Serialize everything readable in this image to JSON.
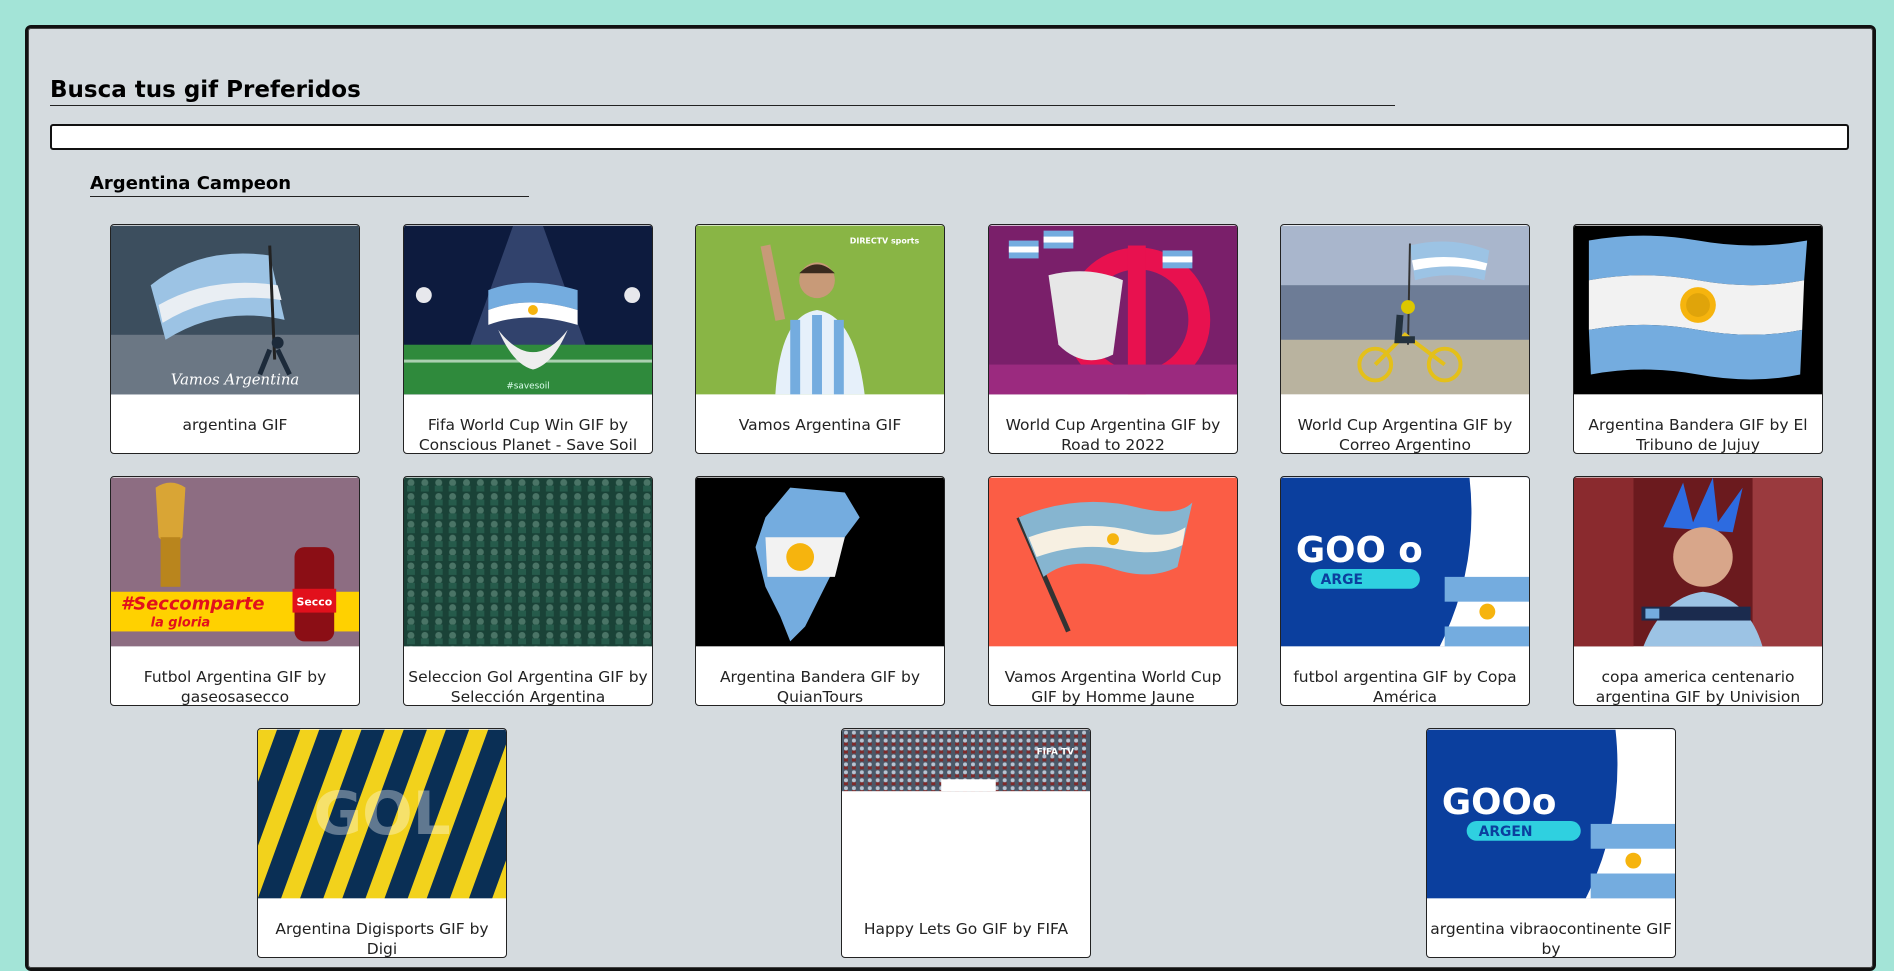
{
  "header": {
    "title": "Busca tus gif Preferidos"
  },
  "search": {
    "value": "",
    "placeholder": ""
  },
  "section": {
    "title": "Argentina Campeon"
  },
  "gifs": [
    {
      "caption": "argentina GIF",
      "icon": "flag-waver-image"
    },
    {
      "caption": "Fifa World Cup Win GIF by Conscious Planet - Save Soil",
      "icon": "mascot-flag-image"
    },
    {
      "caption": "Vamos Argentina GIF",
      "icon": "player-waving-image"
    },
    {
      "caption": "World Cup Argentina GIF by Road to 2022",
      "icon": "mascot-purple-image"
    },
    {
      "caption": "World Cup Argentina GIF by Correo Argentino",
      "icon": "cyclist-flag-image"
    },
    {
      "caption": "Argentina Bandera GIF by El Tribuno de Jujuy",
      "icon": "waving-flag-image"
    },
    {
      "caption": "Futbol Argentina GIF by gaseosasecco",
      "icon": "trophy-soda-image"
    },
    {
      "caption": "Seleccion Gol Argentina GIF by Selección Argentina",
      "icon": "crowd-image"
    },
    {
      "caption": "Argentina Bandera GIF by QuianTours",
      "icon": "map-flag-image"
    },
    {
      "caption": "Vamos Argentina World Cup GIF by Homme Jaune",
      "icon": "flag-illustration-image"
    },
    {
      "caption": "futbol argentina GIF by Copa América",
      "icon": "goal-banner-image"
    },
    {
      "caption": "copa america centenario argentina GIF by Univision Deportes",
      "icon": "fan-wig-image"
    },
    {
      "caption": "Argentina Digisports GIF by Digi",
      "icon": "stripes-gol-image"
    },
    {
      "caption": "Happy Lets Go GIF by FIFA",
      "icon": "stadium-image"
    },
    {
      "caption": "argentina vibraocontinente GIF by",
      "icon": "goal-banner-image"
    }
  ],
  "overlay_text": {
    "gif1": "Vamos Argentina",
    "gif2": "#savesoil",
    "gif3": "DIRECTV sports",
    "gif7_line1": "#Seccomparte",
    "gif7_line2": "la gloria",
    "gif7_brand": "Secco",
    "gif11": "GOO o",
    "gif11_sub": "ARGE",
    "gif15": "GOOo",
    "gif15_sub": "ARGEN",
    "gif13": "GOL",
    "gif14": "FIFA TV"
  },
  "colors": {
    "page_bg": "#a3e4d7",
    "panel_bg": "#d5dbdf",
    "argentina_blue": "#74acdf",
    "sun_yellow": "#f6b40e"
  }
}
